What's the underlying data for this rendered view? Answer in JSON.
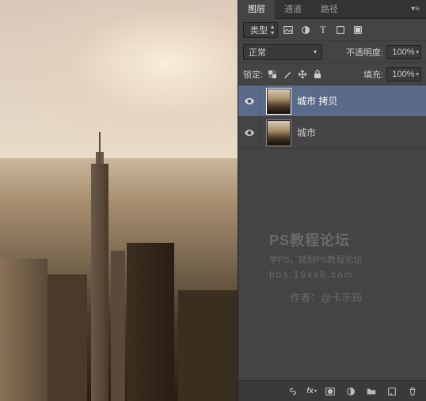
{
  "tabs": {
    "layers": "图层",
    "channels": "通道",
    "paths": "路径"
  },
  "filter_row": {
    "type_label": "类型"
  },
  "blend_row": {
    "mode": "正常",
    "opacity_label": "不透明度:",
    "opacity_value": "100%"
  },
  "lock_row": {
    "label": "锁定:",
    "fill_label": "填充:",
    "fill_value": "100%"
  },
  "layers": [
    {
      "name": "城市 拷贝",
      "visible": true,
      "selected": true
    },
    {
      "name": "城市",
      "visible": true,
      "selected": false
    }
  ],
  "watermark": {
    "line1": "PS教程论坛",
    "line2": "学PS，就到PS教程论坛",
    "line3": "bbs.16xx8.com",
    "line4": "作者：@卡乐筠"
  },
  "icons": {
    "menu": "menu-icon",
    "search": "search-icon",
    "image": "image-filter-icon",
    "adjust": "adjustment-filter-icon",
    "type": "type-filter-icon",
    "shape": "shape-filter-icon",
    "smart": "smart-filter-icon",
    "eye": "eye-icon",
    "link": "link-icon",
    "fx": "fx-icon",
    "mask": "mask-icon",
    "adjust2": "adjustment-layer-icon",
    "group": "group-icon",
    "new": "new-layer-icon",
    "trash": "trash-icon",
    "pixel": "lock-pixels-icon",
    "brush": "lock-brush-icon",
    "move": "lock-move-icon",
    "lock": "lock-all-icon"
  }
}
